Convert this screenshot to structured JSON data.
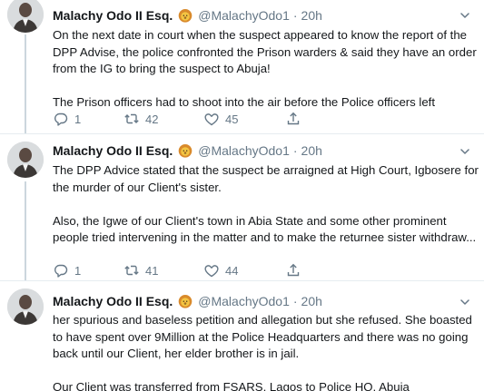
{
  "author": {
    "name": "Malachy Odo II Esq.",
    "handle": "@MalachyOdo1",
    "separator": "·"
  },
  "tweets": [
    {
      "time": "20h",
      "paragraphs": [
        "On the next date in court when the suspect appeared to know the report of the DPP Advise, the police confronted the Prison warders & said they have an order from the IG to bring the suspect to Abuja!",
        "The Prison officers had to shoot into the air before the Police officers left"
      ],
      "replies": "1",
      "retweets": "42",
      "likes": "45"
    },
    {
      "time": "20h",
      "paragraphs": [
        "The DPP Advice stated that the suspect be arraigned at High Court, Igbosere for the murder of our Client's sister.",
        "Also, the Igwe of our Client's town in Abia State and some other prominent people tried intervening in the matter and to make the returnee sister withdraw..."
      ],
      "replies": "1",
      "retweets": "41",
      "likes": "44"
    },
    {
      "time": "20h",
      "paragraphs": [
        "her spurious and baseless petition and allegation but she refused. She boasted to have spent over 9Million at the Police Headquarters and there was no going back until our Client, her elder brother is in jail.",
        "Our Client was transferred from FSARS, Lagos to Police HQ, Abuja"
      ]
    }
  ],
  "icons": {
    "badge": "lion-emoji-icon",
    "reply": "reply-icon",
    "retweet": "retweet-icon",
    "like": "heart-icon",
    "share": "share-icon",
    "more": "chevron-down-icon"
  },
  "colors": {
    "text": "#14171a",
    "secondary": "#657786",
    "divider": "#e6ecf0",
    "thread_line": "#ccd6dd"
  }
}
